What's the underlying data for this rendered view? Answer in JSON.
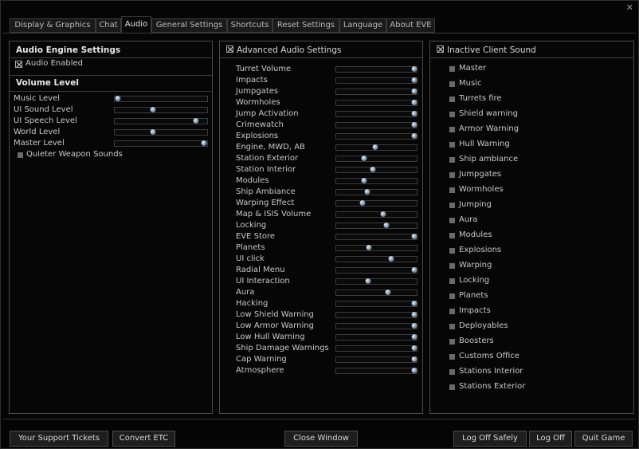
{
  "tabs": [
    {
      "label": "Display & Graphics",
      "active": false
    },
    {
      "label": "Chat",
      "active": false
    },
    {
      "label": "Audio",
      "active": true
    },
    {
      "label": "General Settings",
      "active": false
    },
    {
      "label": "Shortcuts",
      "active": false
    },
    {
      "label": "Reset Settings",
      "active": false
    },
    {
      "label": "Language",
      "active": false
    },
    {
      "label": "About EVE",
      "active": false
    }
  ],
  "audio_engine": {
    "title": "Audio Engine Settings",
    "enabled_label": "Audio Enabled",
    "enabled": true,
    "volume_title": "Volume Level",
    "sliders": [
      {
        "label": "Music Level",
        "value": 0.0
      },
      {
        "label": "UI Sound Level",
        "value": 0.41
      },
      {
        "label": "UI Speech Level",
        "value": 0.91
      },
      {
        "label": "World Level",
        "value": 0.41
      },
      {
        "label": "Master Level",
        "value": 1.0
      }
    ],
    "quieter_label": "Quieter Weapon Sounds",
    "quieter_checked": false
  },
  "advanced": {
    "title": "Advanced Audio Settings",
    "checked": true,
    "sliders": [
      {
        "label": "Turret Volume",
        "value": 1.0
      },
      {
        "label": "Impacts",
        "value": 1.0
      },
      {
        "label": "Jumpgates",
        "value": 1.0
      },
      {
        "label": "Wormholes",
        "value": 1.0
      },
      {
        "label": "Jump Activation",
        "value": 1.0
      },
      {
        "label": "Crimewatch",
        "value": 1.0
      },
      {
        "label": "Explosions",
        "value": 1.0
      },
      {
        "label": "Engine, MWD, AB",
        "value": 0.48
      },
      {
        "label": "Station Exterior",
        "value": 0.34
      },
      {
        "label": "Station Interior",
        "value": 0.45
      },
      {
        "label": "Modules",
        "value": 0.34
      },
      {
        "label": "Ship Ambiance",
        "value": 0.38
      },
      {
        "label": "Warping Effect",
        "value": 0.32
      },
      {
        "label": "Map & ISIS Volume",
        "value": 0.59
      },
      {
        "label": "Locking",
        "value": 0.63
      },
      {
        "label": "EVE Store",
        "value": 1.0
      },
      {
        "label": "Planets",
        "value": 0.4
      },
      {
        "label": "UI click",
        "value": 0.69
      },
      {
        "label": "Radial Menu",
        "value": 1.0
      },
      {
        "label": "UI Interaction",
        "value": 0.39
      },
      {
        "label": "Aura",
        "value": 0.65
      },
      {
        "label": "Hacking",
        "value": 1.0
      },
      {
        "label": "Low Shield Warning",
        "value": 1.0
      },
      {
        "label": "Low Armor Warning",
        "value": 1.0
      },
      {
        "label": "Low Hull Warning",
        "value": 1.0
      },
      {
        "label": "Ship Damage Warnings",
        "value": 1.0
      },
      {
        "label": "Cap Warning",
        "value": 1.0
      },
      {
        "label": "Atmosphere",
        "value": 1.0
      }
    ]
  },
  "inactive": {
    "title": "Inactive Client Sound",
    "checked": true,
    "items": [
      "Master",
      "Music",
      "Turrets fire",
      "Shield warning",
      "Armor Warning",
      "Hull Warning",
      "Ship ambiance",
      "Jumpgates",
      "Wormholes",
      "Jumping",
      "Aura",
      "Modules",
      "Explosions",
      "Warping",
      "Locking",
      "Planets",
      "Impacts",
      "Deployables",
      "Boosters",
      "Customs Office",
      "Stations Interior",
      "Stations Exterior"
    ]
  },
  "footer": {
    "support": "Your Support Tickets",
    "convert": "Convert ETC",
    "close": "Close Window",
    "logoff_safely": "Log Off Safely",
    "logoff": "Log Off",
    "quit": "Quit Game"
  },
  "window_close_glyph": "✕"
}
